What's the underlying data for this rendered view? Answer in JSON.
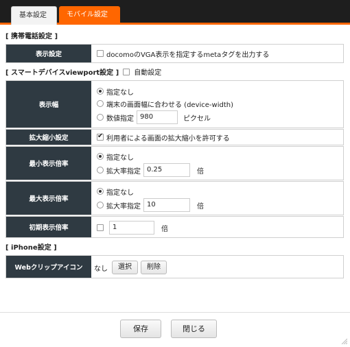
{
  "tabs": [
    {
      "label": "基本設定",
      "active": false
    },
    {
      "label": "モバイル設定",
      "active": true
    }
  ],
  "mobile_section": {
    "title": "[ 携帯電話設定 ]"
  },
  "display_setting": {
    "label": "表示設定",
    "option_label": "docomoのVGA表示を指定するmetaタグを出力する",
    "checked": false
  },
  "viewport_section": {
    "title": "[ スマートデバイスviewport設定 ]",
    "auto_label": "自動設定",
    "auto_checked": false
  },
  "display_width": {
    "label": "表示幅",
    "options": [
      "指定なし",
      "端末の画面幅に合わせる (device-width)",
      "数値指定"
    ],
    "selected": "指定なし",
    "value": "980",
    "unit": "ピクセル"
  },
  "zoom_setting": {
    "label": "拡大縮小設定",
    "option_label": "利用者による画面の拡大縮小を許可する",
    "checked": true
  },
  "min_scale": {
    "label": "最小表示倍率",
    "options": [
      "指定なし",
      "拡大率指定"
    ],
    "selected": "指定なし",
    "value": "0.25",
    "unit": "倍"
  },
  "max_scale": {
    "label": "最大表示倍率",
    "options": [
      "指定なし",
      "拡大率指定"
    ],
    "selected": "指定なし",
    "value": "10",
    "unit": "倍"
  },
  "initial_scale": {
    "label": "初期表示倍率",
    "value": "1",
    "unit": "倍",
    "checked": false
  },
  "iphone_section": {
    "title": "[ iPhone設定 ]"
  },
  "webclip": {
    "label": "Webクリップアイコン",
    "value": "なし",
    "select_label": "選択",
    "delete_label": "削除"
  },
  "footer": {
    "save_label": "保存",
    "close_label": "閉じる"
  },
  "colors": {
    "accent": "#ff6600",
    "label_bg": "#2f3a42",
    "topbar": "#1e1e1e"
  }
}
